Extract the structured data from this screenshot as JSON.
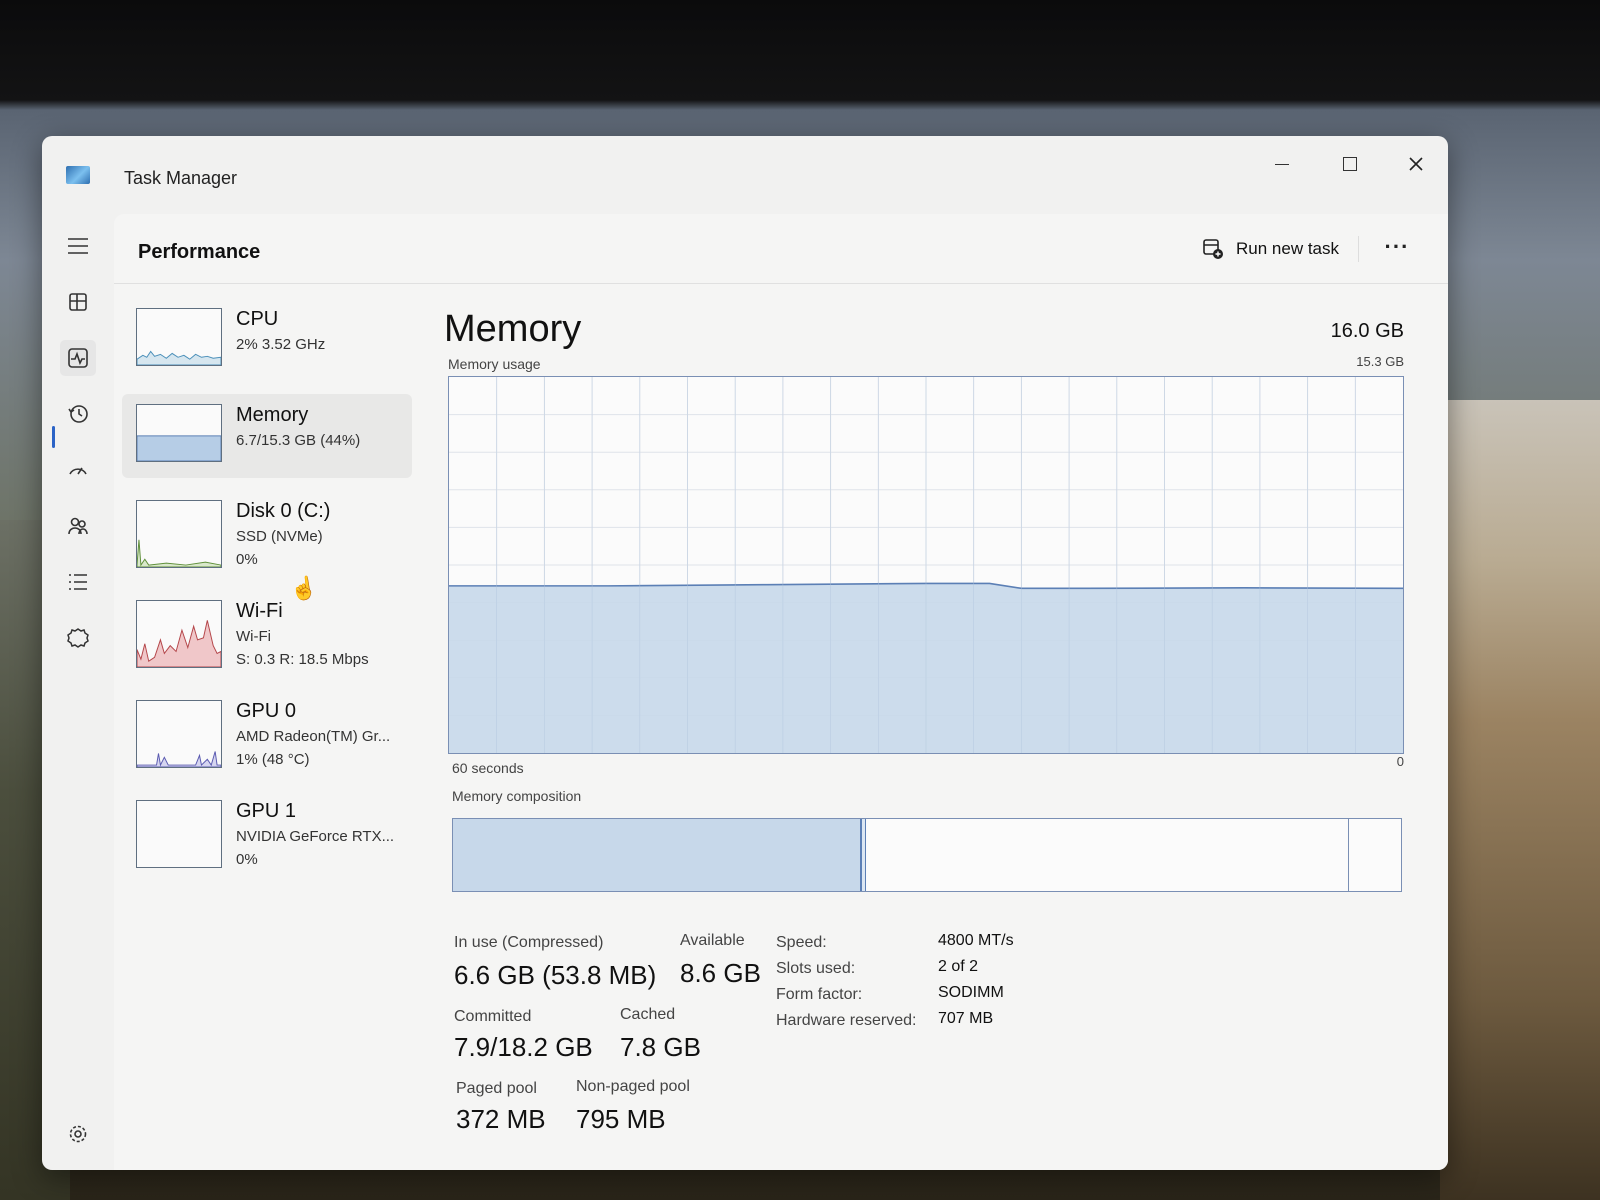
{
  "window": {
    "title": "Task Manager"
  },
  "window_controls": {
    "minimize": "—",
    "maximize": "",
    "close": "✕"
  },
  "header": {
    "title": "Performance",
    "run_new_task": "Run new task",
    "more": "···"
  },
  "nav": {
    "items": [
      "menu-icon",
      "processes-icon",
      "performance-icon",
      "app-history-icon",
      "startup-apps-icon",
      "users-icon",
      "details-icon",
      "services-icon",
      "settings-icon"
    ],
    "active": "performance-icon"
  },
  "sidebar": {
    "items": [
      {
        "name": "CPU",
        "sub": "2% 3.52 GHz",
        "sub2": "",
        "color": "#4a8fb9"
      },
      {
        "name": "Memory",
        "sub": "6.7/15.3 GB (44%)",
        "sub2": "",
        "color": "#5b7fb5"
      },
      {
        "name": "Disk 0 (C:)",
        "sub": "SSD (NVMe)",
        "sub2": "0%",
        "color": "#5f8f3a"
      },
      {
        "name": "Wi-Fi",
        "sub": "Wi-Fi",
        "sub2": "S: 0.3 R: 18.5 Mbps",
        "color": "#b4464a"
      },
      {
        "name": "GPU 0",
        "sub": "AMD Radeon(TM) Gr...",
        "sub2": "1% (48 °C)",
        "color": "#5a5ab0"
      },
      {
        "name": "GPU 1",
        "sub": "NVIDIA GeForce RTX...",
        "sub2": "0%",
        "color": "#5a5ab0"
      }
    ],
    "selected": "Memory"
  },
  "main": {
    "title": "Memory",
    "total": "16.0 GB",
    "usage_label": "Memory usage",
    "usage_max": "15.3 GB",
    "x_left": "60 seconds",
    "x_right": "0",
    "composition_label": "Memory composition",
    "composition": {
      "in_use_gb": 6.6,
      "modified_gb": 0.05,
      "standby_gb": 7.8,
      "free_gb": 0.8,
      "total_gb": 15.3
    },
    "stats": {
      "in_use_label": "In use (Compressed)",
      "in_use_value": "6.6 GB (53.8 MB)",
      "available_label": "Available",
      "available_value": "8.6 GB",
      "committed_label": "Committed",
      "committed_value": "7.9/18.2 GB",
      "cached_label": "Cached",
      "cached_value": "7.8 GB",
      "paged_label": "Paged pool",
      "paged_value": "372 MB",
      "nonpaged_label": "Non-paged pool",
      "nonpaged_value": "795 MB"
    },
    "specs": {
      "speed_label": "Speed:",
      "speed_value": "4800 MT/s",
      "slots_label": "Slots used:",
      "slots_value": "2 of 2",
      "form_label": "Form factor:",
      "form_value": "SODIMM",
      "reserved_label": "Hardware reserved:",
      "reserved_value": "707 MB"
    }
  },
  "chart_data": [
    {
      "type": "area",
      "title": "Memory usage",
      "xlabel": "60 seconds",
      "ylabel": "",
      "ylim": [
        0,
        15.3
      ],
      "xlim": [
        60,
        0
      ],
      "grid": true,
      "color": "#c7d8ea",
      "line_color": "#5b7fb5",
      "series": [
        {
          "x": [
            60,
            50,
            40,
            30,
            26,
            24,
            20,
            10,
            0
          ],
          "y": [
            6.8,
            6.8,
            6.85,
            6.9,
            6.9,
            6.7,
            6.7,
            6.72,
            6.7
          ]
        }
      ]
    }
  ]
}
